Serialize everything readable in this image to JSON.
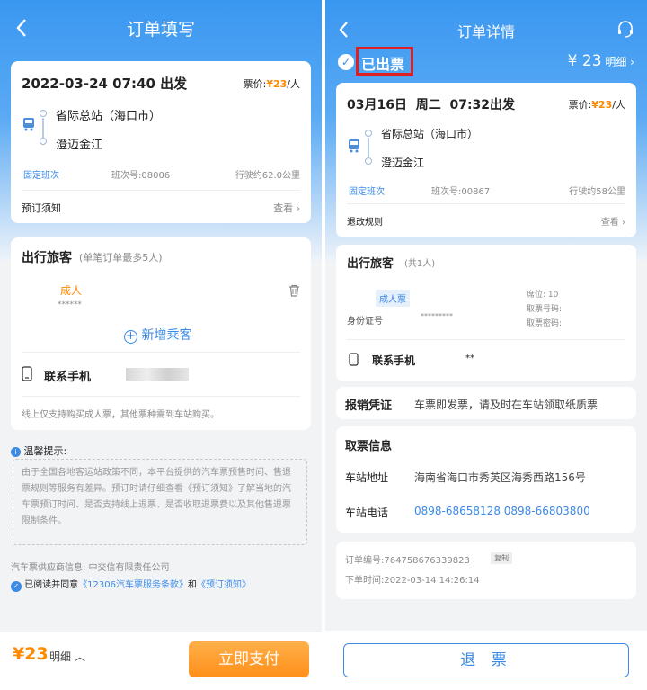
{
  "left": {
    "header_title": "订单填写",
    "trip": {
      "datetime": "2022-03-24 07:40 出发",
      "price_label": "票价:",
      "price_value": "¥23",
      "price_unit": "/人",
      "from": "省际总站（海口市）",
      "to": "澄迈金江",
      "tag": "固定班次",
      "bus_no": "班次号:08006",
      "distance": "行驶约62.0公里",
      "notice_label": "预订须知",
      "notice_link": "查看"
    },
    "passengers": {
      "title": "出行旅客",
      "subtitle": "(单笔订单最多5人)",
      "type": "成人",
      "masked_id": "******",
      "add_label": "新增乘客",
      "phone_label": "联系手机",
      "note": "线上仅支持购买成人票，其他票种需到车站购买。"
    },
    "tips": {
      "title": "温馨提示:",
      "body": "由于全国各地客运站政策不同，本平台提供的汽车票预售时间、售退票规则等服务有差异。预订时请仔细查看《预订须知》了解当地的汽车票预订时间、是否支持线上退票、是否收取退票费以及其他售退票限制条件。"
    },
    "supplier": "汽车票供应商信息: 中交信有限责任公司",
    "agree_prefix": "已阅读并同意",
    "agree_link1": "《12306汽车票服务条款》",
    "agree_and": "和",
    "agree_link2": "《预订须知》",
    "pay": {
      "total": "¥23",
      "detail": "明细",
      "button": "立即支付"
    }
  },
  "right": {
    "header_title": "订单详情",
    "status": "已出票",
    "total": "¥ 23",
    "detail": "明细",
    "trip": {
      "date": "03月16日",
      "weekday": "周二",
      "time": "07:32出发",
      "price_label": "票价:",
      "price_value": "¥23",
      "price_unit": "/人",
      "from": "省际总站（海口市）",
      "to": "澄迈金江",
      "tag": "固定班次",
      "bus_no": "班次号:00867",
      "distance": "行驶约58公里",
      "rules_label": "退改规则",
      "rules_link": "查看"
    },
    "passengers": {
      "title": "出行旅客",
      "subtitle": "(共1人)",
      "type": "成人票",
      "id_label": "身份证号",
      "id_value": "*********",
      "seat_label": "席位: 10",
      "ticket_no_label": "取票号码:",
      "ticket_pwd_label": "取票密码:",
      "phone_label": "联系手机",
      "phone_value": "**"
    },
    "invoice": {
      "label": "报销凭证",
      "text": "车票即发票，请及时在车站领取纸质票"
    },
    "pickup": {
      "title": "取票信息",
      "addr_label": "车站地址",
      "addr_value": "海南省海口市秀英区海秀西路156号",
      "tel_label": "车站电话",
      "tel_value": "0898-68658128 0898-66803800"
    },
    "order": {
      "no": "订单编号:764758676339823",
      "copy": "复制",
      "time": "下单时间:2022-03-14 14:26:14"
    },
    "refund_button": "退 票"
  },
  "colors": {
    "primary": "#3b8ae6",
    "accent": "#ff8a00",
    "highlight": "#e02020"
  },
  "icons": [
    "back-arrow-icon",
    "bus-icon",
    "trash-icon",
    "plus-circle-icon",
    "phone-icon",
    "info-icon",
    "check-circle-icon",
    "headset-icon",
    "chevron-right-icon"
  ]
}
